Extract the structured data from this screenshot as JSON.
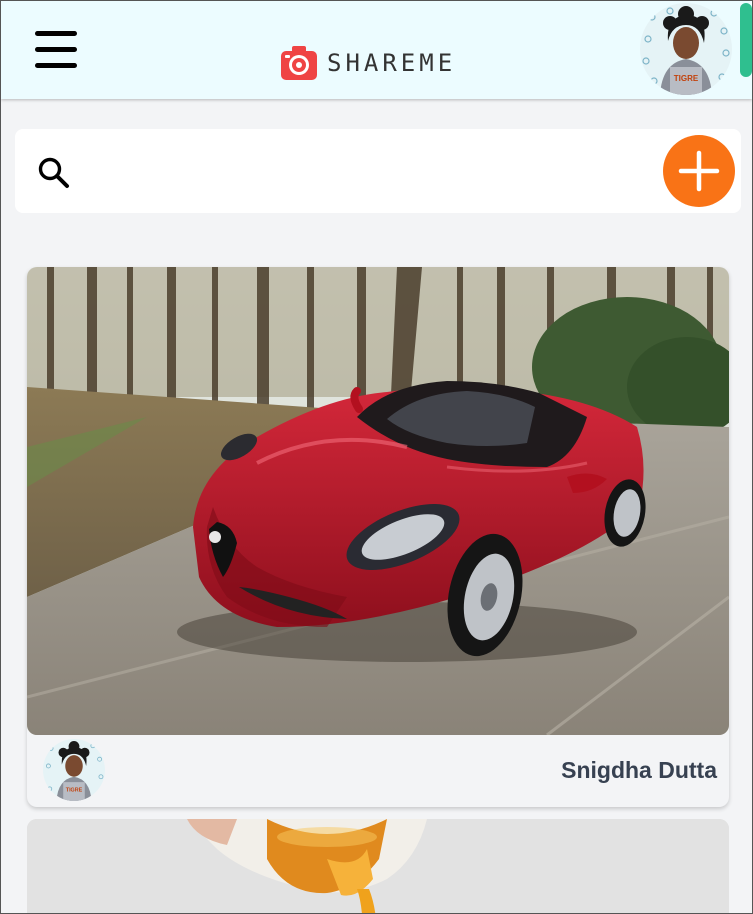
{
  "app": {
    "brand": "SHAREME"
  },
  "header": {
    "menu_icon": "hamburger-icon",
    "logo_icon": "camera-icon",
    "accent": "#ef4444"
  },
  "search": {
    "placeholder": "",
    "value": "",
    "icon": "search-icon",
    "add_icon": "plus-icon",
    "add_color": "#f97316"
  },
  "pins": [
    {
      "image": "red sports car",
      "author": "Snigdha Dutta"
    },
    {
      "image": "honey pouring",
      "author": ""
    }
  ]
}
